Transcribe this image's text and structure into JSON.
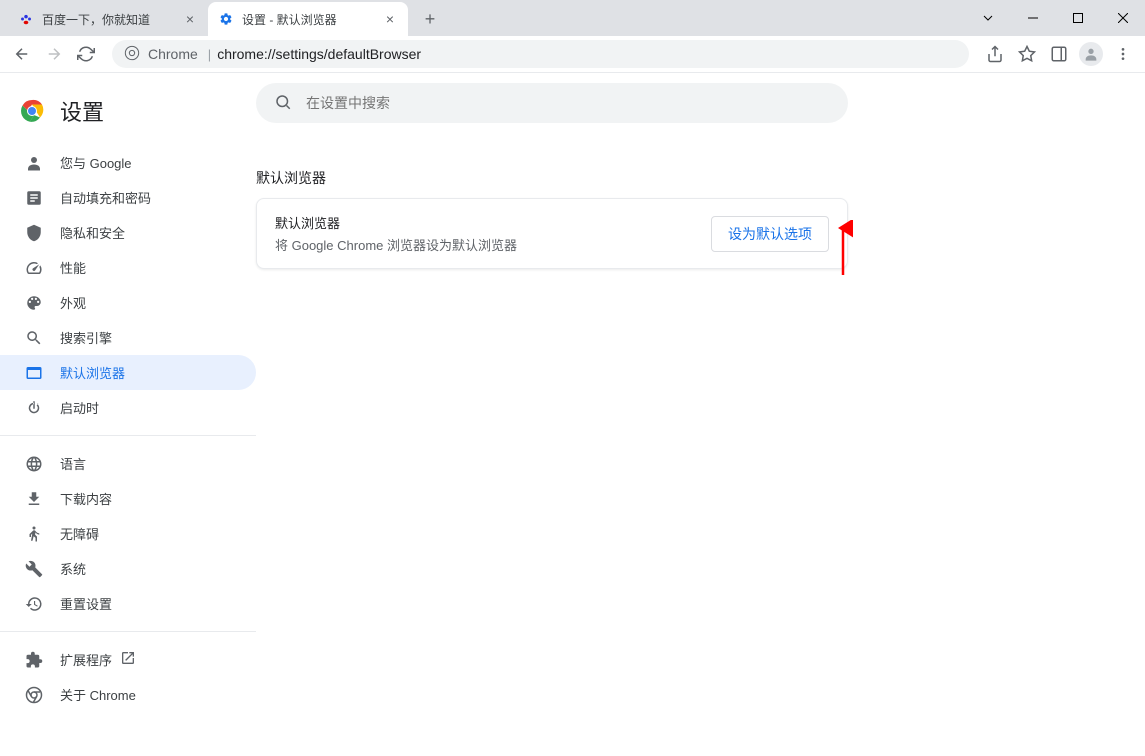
{
  "tabs": [
    {
      "title": "百度一下，你就知道",
      "favicon": "baidu"
    },
    {
      "title": "设置 - 默认浏览器",
      "favicon": "gear"
    }
  ],
  "omnibox": {
    "prefix": "Chrome",
    "url": "chrome://settings/defaultBrowser"
  },
  "settings": {
    "title": "设置",
    "search_placeholder": "在设置中搜索"
  },
  "sidebar": {
    "group1": [
      {
        "label": "您与 Google",
        "icon": "person"
      },
      {
        "label": "自动填充和密码",
        "icon": "autofill"
      },
      {
        "label": "隐私和安全",
        "icon": "shield"
      },
      {
        "label": "性能",
        "icon": "speed"
      },
      {
        "label": "外观",
        "icon": "palette"
      },
      {
        "label": "搜索引擎",
        "icon": "search"
      },
      {
        "label": "默认浏览器",
        "icon": "browser"
      },
      {
        "label": "启动时",
        "icon": "power"
      }
    ],
    "group2": [
      {
        "label": "语言",
        "icon": "globe"
      },
      {
        "label": "下载内容",
        "icon": "download"
      },
      {
        "label": "无障碍",
        "icon": "accessibility"
      },
      {
        "label": "系统",
        "icon": "wrench"
      },
      {
        "label": "重置设置",
        "icon": "restore"
      }
    ],
    "group3": [
      {
        "label": "扩展程序",
        "icon": "extension",
        "external": true
      },
      {
        "label": "关于 Chrome",
        "icon": "chrome"
      }
    ]
  },
  "section": {
    "title": "默认浏览器",
    "card_title": "默认浏览器",
    "card_desc": "将 Google Chrome 浏览器设为默认浏览器",
    "button": "设为默认选项"
  }
}
